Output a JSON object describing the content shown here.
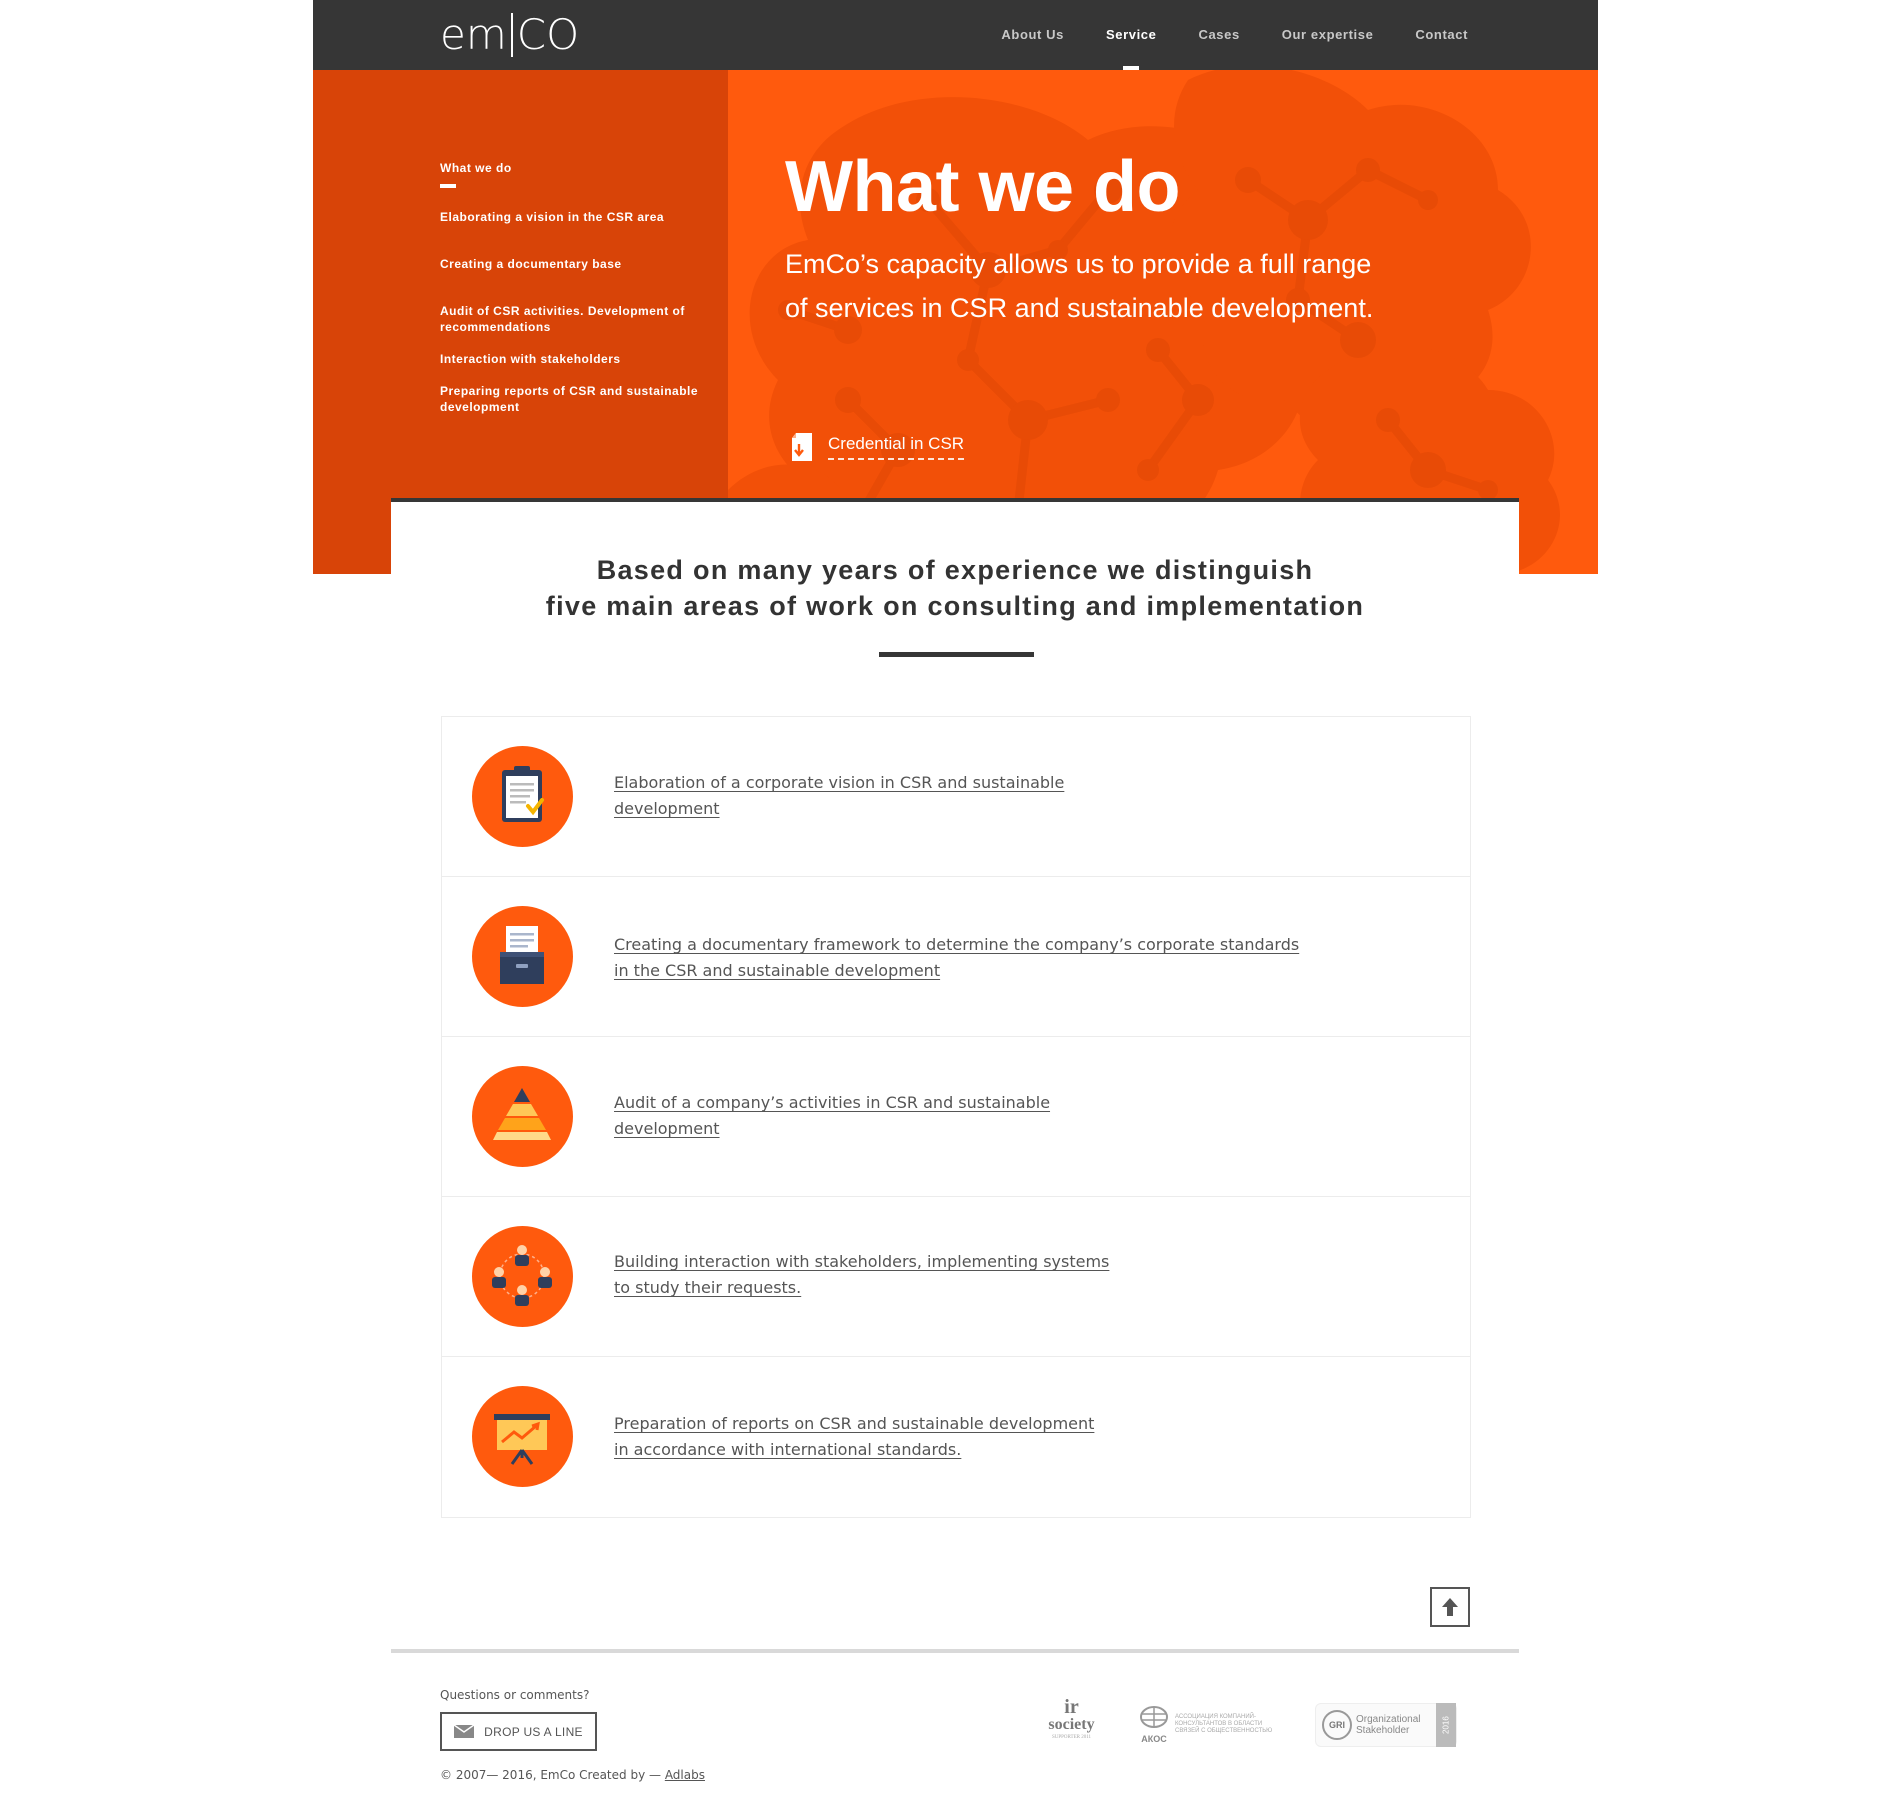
{
  "brand": {
    "left": "em",
    "right": "CO"
  },
  "nav": [
    {
      "label": "About Us",
      "active": false
    },
    {
      "label": "Service",
      "active": true
    },
    {
      "label": "Cases",
      "active": false
    },
    {
      "label": "Our expertise",
      "active": false
    },
    {
      "label": "Contact",
      "active": false
    }
  ],
  "subnav": [
    "What we do",
    "Elaborating a vision in the CSR area",
    "Creating a documentary base",
    "Audit of CSR activities. Development of recommendations",
    "Interaction with stakeholders",
    "Preparing reports of CSR and sustainable development"
  ],
  "hero": {
    "title": "What we do",
    "text": "EmCo’s capacity allows us to provide a full range of services in CSR and sustainable development.",
    "credential_link": "Credential in CSR"
  },
  "intro": {
    "line1": "Based on many years of experience we distinguish",
    "line2": "five main areas of work on consulting and implementation"
  },
  "areas": [
    {
      "icon": "clipboard-icon",
      "line1": "Elaboration of a corporate vision in CSR and sustainable",
      "line2": "development"
    },
    {
      "icon": "document-box-icon",
      "line1": "Creating a documentary framework to determine the company’s corporate standards",
      "line2": "in the CSR and sustainable development"
    },
    {
      "icon": "pyramid-icon",
      "line1": "Audit of a company’s activities in CSR and sustainable",
      "line2": "development"
    },
    {
      "icon": "people-network-icon",
      "line1": "Building interaction with stakeholders, implementing systems",
      "line2": "to study their requests."
    },
    {
      "icon": "presentation-board-icon",
      "line1": "Preparation of reports on CSR and sustainable development",
      "line2": "in accordance with international standards."
    }
  ],
  "footer": {
    "question": "Questions or comments?",
    "button": "DROP US A LINE",
    "copyright": "© 2007— 2016, EmCo   Created by —",
    "creator_link": "Adlabs",
    "partners": {
      "ir_big": "ir",
      "ir_small": "society",
      "ir_tag": "SUPPORTER 2011",
      "akos_short": "АКОС",
      "akos_text": "АССОЦИАЦИЯ КОМПАНИЙ-КОНСУЛЬТАНТОВ В ОБЛАСТИ СВЯЗЕЙ С ОБЩЕСТВЕННОСТЬЮ",
      "gri_short": "GRI",
      "gri_text": "Organizational Stakeholder",
      "gri_year": "2016"
    }
  },
  "colors": {
    "accent": "#ff5a0d",
    "accent_dark": "#d84408",
    "topbar": "#363636"
  }
}
